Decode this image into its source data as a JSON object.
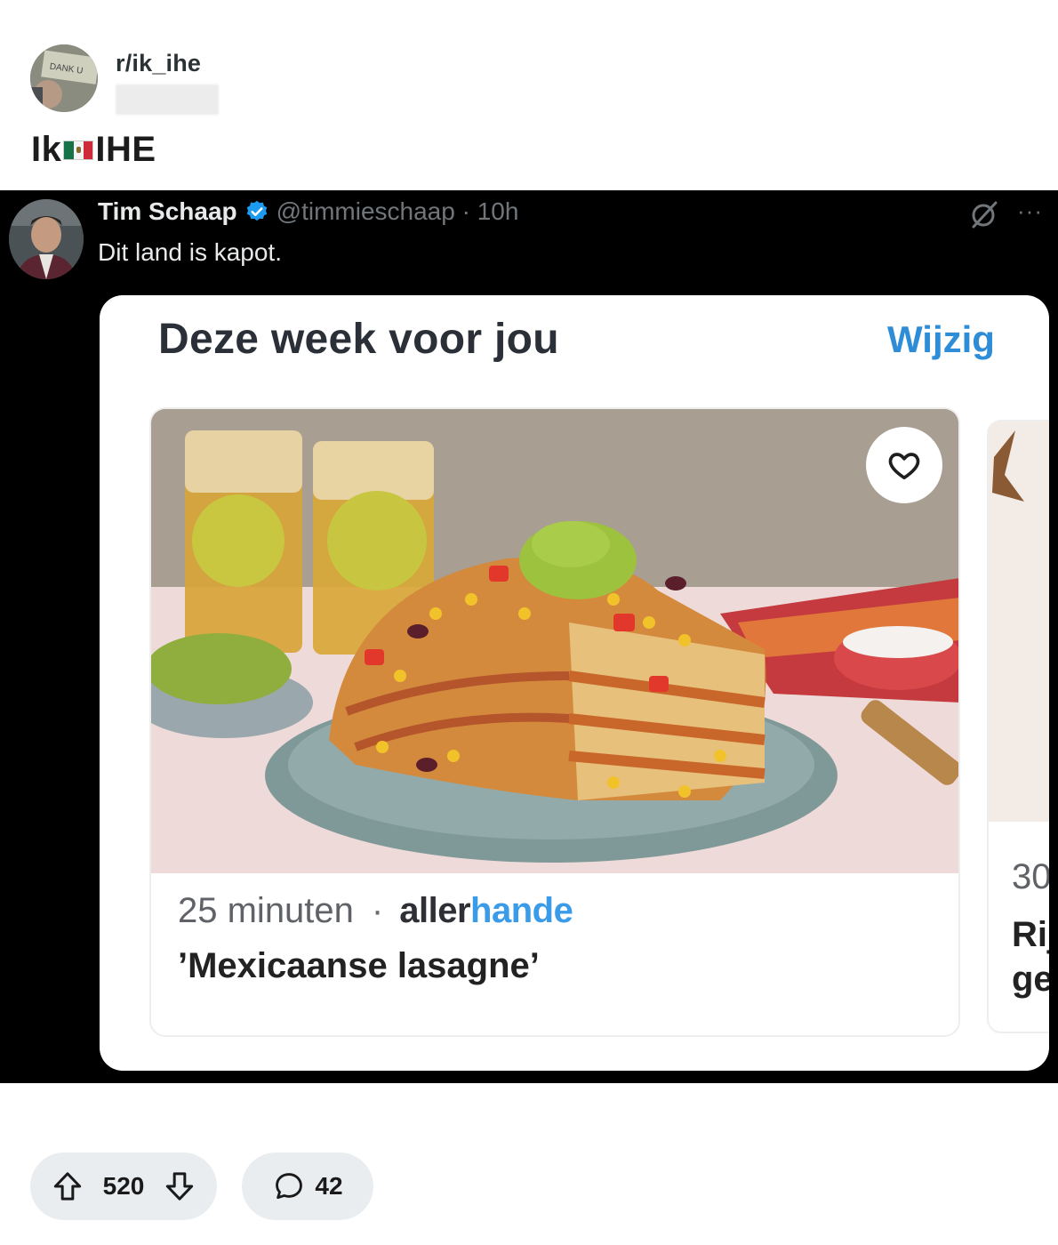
{
  "subreddit": {
    "name": "r/ik_ihe",
    "avatar_text": "DANK U",
    "timestamp_blurred": ""
  },
  "post": {
    "title_prefix": "Ik",
    "title_flag": "mexico-flag-emoji",
    "title_suffix": "IHE"
  },
  "tweet": {
    "author_name": "Tim Schaap",
    "handle_time": "@timmieschaap · 10h",
    "verified_color": "#1d9bf0",
    "text": "Dit land is kapot.",
    "more_label": "···"
  },
  "card": {
    "title": "Deze week voor jou",
    "action_label": "Wijzig",
    "recipes": [
      {
        "time": "25 minuten",
        "separator": "·",
        "brand_a": "aller",
        "brand_b": "hande",
        "name": "’Mexicaanse lasagne’"
      },
      {
        "time": "30",
        "name": "Rij\nge"
      }
    ]
  },
  "actions": {
    "upvotes": "520",
    "comments": "42"
  }
}
